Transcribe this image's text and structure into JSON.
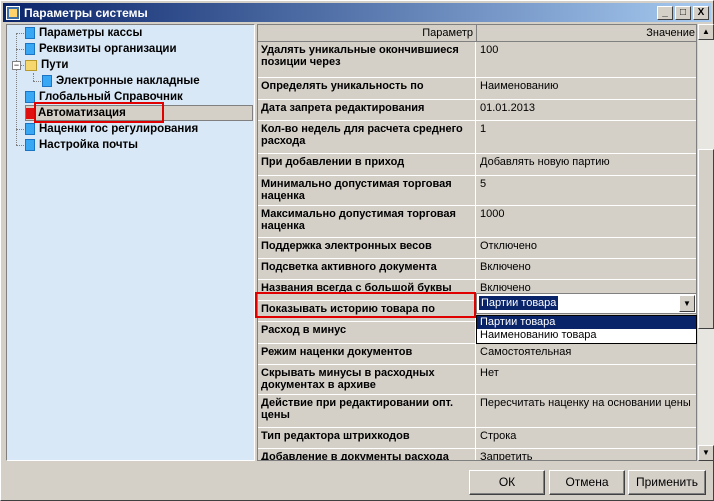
{
  "window": {
    "title": "Параметры системы",
    "buttons": [
      "_",
      "□",
      "X"
    ]
  },
  "tree": {
    "items": [
      {
        "label": "Параметры кассы"
      },
      {
        "label": "Реквизиты организации"
      },
      {
        "label": "Пути"
      },
      {
        "label": "Электронные накладные"
      },
      {
        "label": "Глобальный Справочник"
      },
      {
        "label": "Автоматизация"
      },
      {
        "label": "Наценки гос регулирования"
      },
      {
        "label": "Настройка почты"
      }
    ]
  },
  "grid": {
    "headers": {
      "param": "Параметр",
      "value": "Значение"
    },
    "rows": [
      {
        "name": "Удалять уникальные окончившиеся позиции через",
        "value": "100"
      },
      {
        "name": "Определять уникальность по",
        "value": "Наименованию"
      },
      {
        "name": "Дата запрета редактирования",
        "value": "01.01.2013"
      },
      {
        "name": "Кол-во недель для расчета среднего расхода",
        "value": "1"
      },
      {
        "name": "При добавлении в приход",
        "value": "Добавлять новую партию"
      },
      {
        "name": "Минимально допустимая торговая наценка",
        "value": "5"
      },
      {
        "name": "Максимально допустимая торговая наценка",
        "value": "1000"
      },
      {
        "name": "Поддержка электронных весов",
        "value": "Отключено"
      },
      {
        "name": "Подсветка активного документа",
        "value": "Включено"
      },
      {
        "name": "Названия всегда с большой буквы",
        "value": "Включено"
      },
      {
        "name": "Показывать историю товара по",
        "value": ""
      },
      {
        "name": "Расход в минус",
        "value": ""
      },
      {
        "name": "Режим наценки документов",
        "value": "Самостоятельная"
      },
      {
        "name": "Скрывать минусы в расходных документах в архиве",
        "value": "Нет"
      },
      {
        "name": "Действие при редактировании опт. цены",
        "value": "Пересчитать наценку на основании цены"
      },
      {
        "name": "Тип редактора штрихкодов",
        "value": "Строка"
      },
      {
        "name": "Добавление в документы расхода позиций без партий",
        "value": "Запретить"
      }
    ]
  },
  "combo": {
    "selected": "Партии товара",
    "options": [
      "Партии товара",
      "Наименованию товара"
    ]
  },
  "footer": {
    "ok": "ОК",
    "cancel": "Отмена",
    "apply": "Применить"
  }
}
